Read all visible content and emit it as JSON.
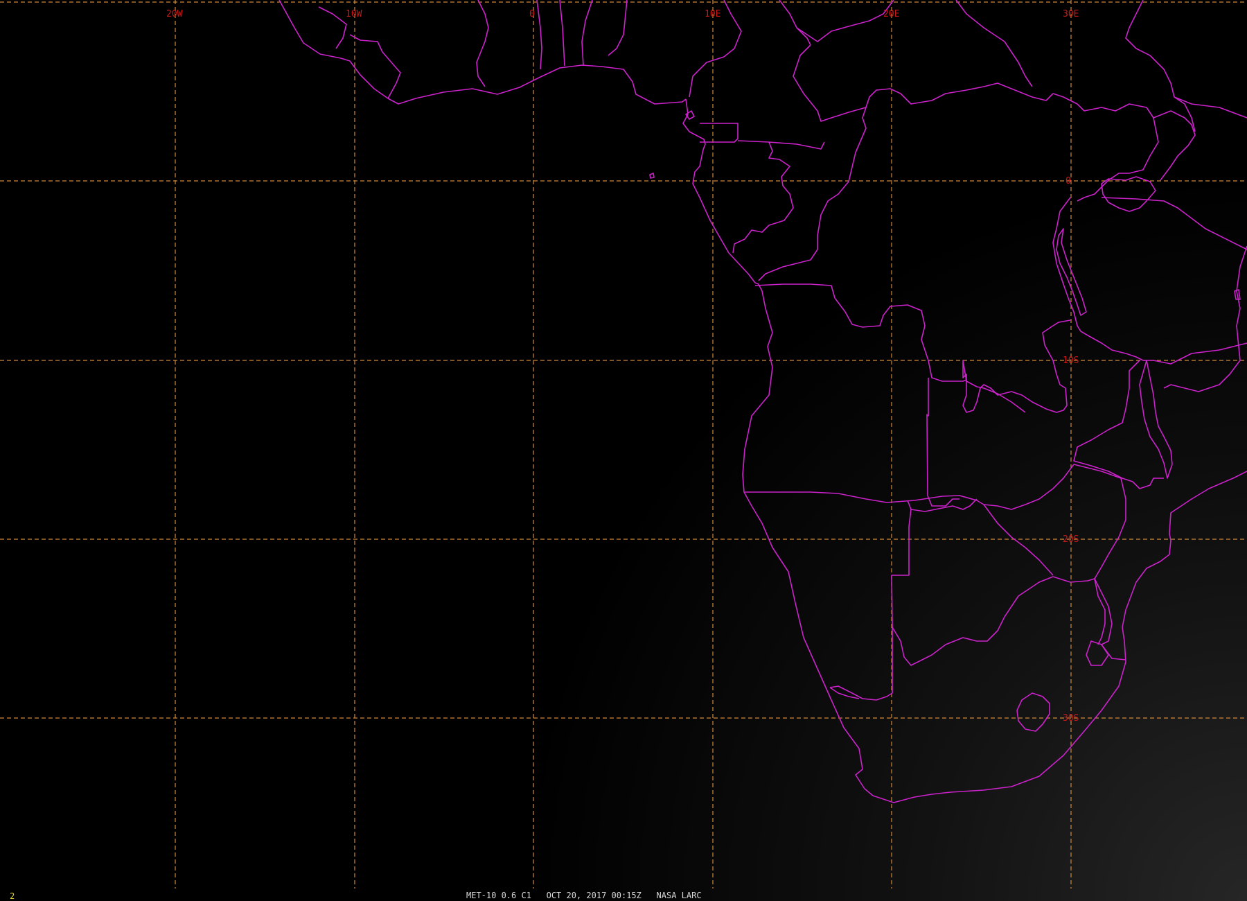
{
  "window": {
    "frame_number": "2",
    "caption": "MET-10 0.6 C1   OCT 20, 2017 00:15Z   NASA LARC"
  },
  "graticule": {
    "longitude_labels": [
      "20W",
      "10W",
      "0",
      "10E",
      "20E",
      "30E"
    ],
    "latitude_labels": [
      "0",
      "10S",
      "20S",
      "30S"
    ]
  },
  "colors": {
    "background": "#000000",
    "coastline_and_borders": "#cc22cc",
    "grid_lines": "#d08a3a",
    "grid_labels": "#d01818",
    "caption_text": "#d8d8d8",
    "frame_number_text": "#e0d020"
  }
}
